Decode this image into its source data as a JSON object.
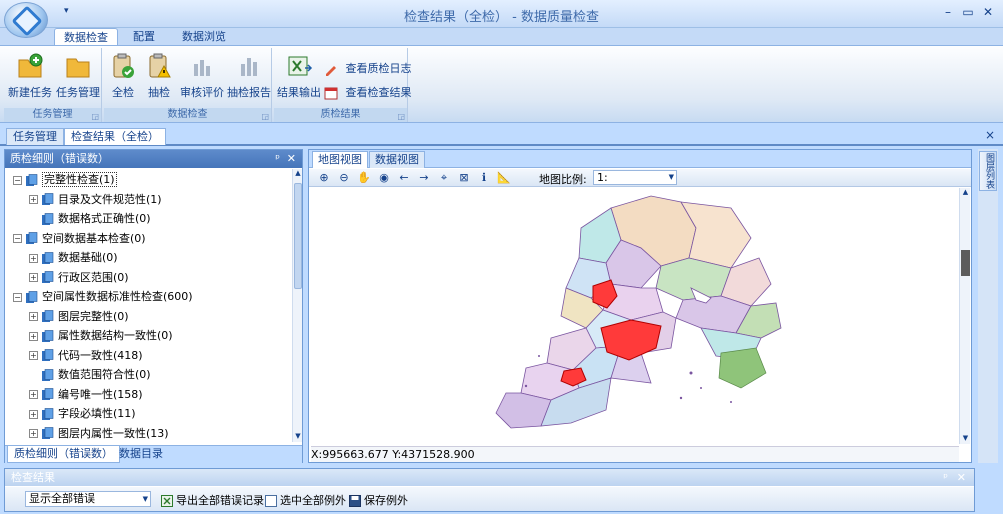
{
  "window": {
    "title": "检查结果（全检） - 数据质量检查",
    "qat": "▾",
    "min": "–",
    "restore": "▭",
    "close": "✕"
  },
  "ribbon": {
    "tabs": [
      "数据检查",
      "配置",
      "数据浏览"
    ],
    "active_tab": 0,
    "groups": [
      {
        "label": "任务管理",
        "buttons": [
          "新建任务",
          "任务管理"
        ]
      },
      {
        "label": "数据检查",
        "buttons": [
          "全检",
          "抽检",
          "审核评价",
          "抽检报告"
        ]
      },
      {
        "label": "质检结果",
        "buttons": [
          "结果输出"
        ],
        "small_buttons": [
          "查看质检日志",
          "查看检查结果"
        ]
      }
    ]
  },
  "doc_tabs": [
    "任务管理",
    "检查结果（全检）"
  ],
  "doc_close": "×",
  "left_panel": {
    "title": "质检细则（错误数）",
    "pin": "ᵖ",
    "close": "✕",
    "tree": [
      {
        "label": "完整性检查(1)",
        "level": 0,
        "expanded": true,
        "selected": true
      },
      {
        "label": "目录及文件规范性(1)",
        "level": 1,
        "expanded": false
      },
      {
        "label": "数据格式正确性(0)",
        "level": 1,
        "leaf": true
      },
      {
        "label": "空间数据基本检查(0)",
        "level": 0,
        "expanded": true
      },
      {
        "label": "数据基础(0)",
        "level": 1,
        "expanded": false
      },
      {
        "label": "行政区范围(0)",
        "level": 1,
        "expanded": false
      },
      {
        "label": "空间属性数据标准性检查(600)",
        "level": 0,
        "expanded": true
      },
      {
        "label": "图层完整性(0)",
        "level": 1,
        "expanded": false
      },
      {
        "label": "属性数据结构一致性(0)",
        "level": 1,
        "expanded": false
      },
      {
        "label": "代码一致性(418)",
        "level": 1,
        "expanded": false
      },
      {
        "label": "数值范围符合性(0)",
        "level": 1,
        "leaf": true
      },
      {
        "label": "编号唯一性(158)",
        "level": 1,
        "expanded": false
      },
      {
        "label": "字段必填性(11)",
        "level": 1,
        "expanded": false
      },
      {
        "label": "图层内属性一致性(13)",
        "level": 1,
        "expanded": false
      }
    ],
    "bottom_tabs": [
      "质检细则（错误数）",
      "数据目录"
    ]
  },
  "map_panel": {
    "tabs": [
      "地图视图",
      "数据视图"
    ],
    "toolbar": {
      "tools": [
        {
          "name": "zoom-in-icon",
          "glyph": "⊕"
        },
        {
          "name": "zoom-out-icon",
          "glyph": "⊖"
        },
        {
          "name": "pan-icon",
          "glyph": "✋"
        },
        {
          "name": "full-extent-icon",
          "glyph": "◉"
        },
        {
          "name": "back-icon",
          "glyph": "←"
        },
        {
          "name": "forward-icon",
          "glyph": "→"
        },
        {
          "name": "select-feature-icon",
          "glyph": "⌖"
        },
        {
          "name": "clear-selection-icon",
          "glyph": "⊠"
        },
        {
          "name": "identify-icon",
          "glyph": "ℹ"
        },
        {
          "name": "measure-icon",
          "glyph": "📐"
        }
      ],
      "scale_label": "地图比例:",
      "scale_value": "1:"
    },
    "coordinates": "X:995663.677 Y:4371528.900"
  },
  "right_strip": {
    "label": "图层列表"
  },
  "bottom_panel": {
    "title": "检查结果",
    "pin": "ᵖ",
    "close": "✕",
    "filter": "显示全部错误",
    "tools": [
      "导出全部错误记录",
      "选中全部例外",
      "保存例外"
    ]
  },
  "colors": {
    "accent": "#15428b",
    "panel_header": "#4575ba",
    "error_fill": "#ff3333",
    "ribbon_bg": "#dfe9f5"
  }
}
